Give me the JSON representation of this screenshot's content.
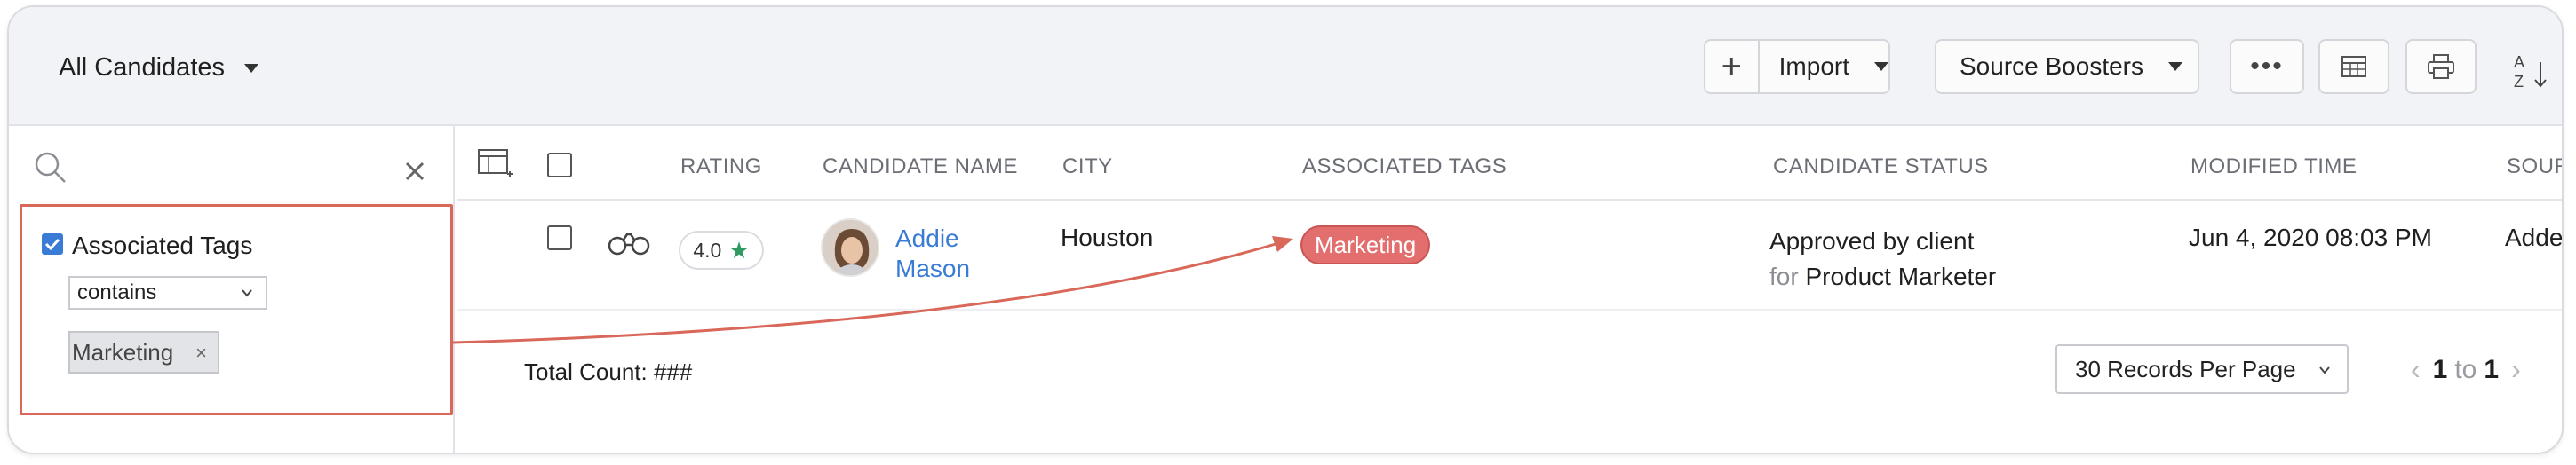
{
  "toolbar": {
    "view_label": "All Candidates",
    "import_label": "Import",
    "boosters_label": "Source Boosters",
    "more_label": "•••"
  },
  "filter": {
    "search_value": "",
    "filter_name": "Associated Tags",
    "operator": "contains",
    "tag_value": "Marketing",
    "tag_remove": "×"
  },
  "table": {
    "headers": {
      "rating": "RATING",
      "candidate_name": "CANDIDATE NAME",
      "city": "CITY",
      "tags": "ASSOCIATED TAGS",
      "status": "CANDIDATE STATUS",
      "modified": "MODIFIED TIME",
      "source": "SOURC"
    },
    "rows": [
      {
        "rating": "4.0",
        "name_first": "Addie",
        "name_last": "Mason",
        "city": "Houston",
        "tag": "Marketing",
        "status": "Approved by client",
        "status_for": "for",
        "status_role": "Product Marketer",
        "modified": "Jun 4, 2020 08:03 PM",
        "source": "Added"
      }
    ]
  },
  "footer": {
    "total_label": "Total Count: ###",
    "per_page": "30 Records Per Page",
    "page_from": "1",
    "page_to_word": "to",
    "page_to": "1"
  },
  "colors": {
    "accent": "#3a7bd5",
    "tag_badge": "#e36e6e",
    "highlight": "#d9685b",
    "star": "#2f9a62"
  }
}
